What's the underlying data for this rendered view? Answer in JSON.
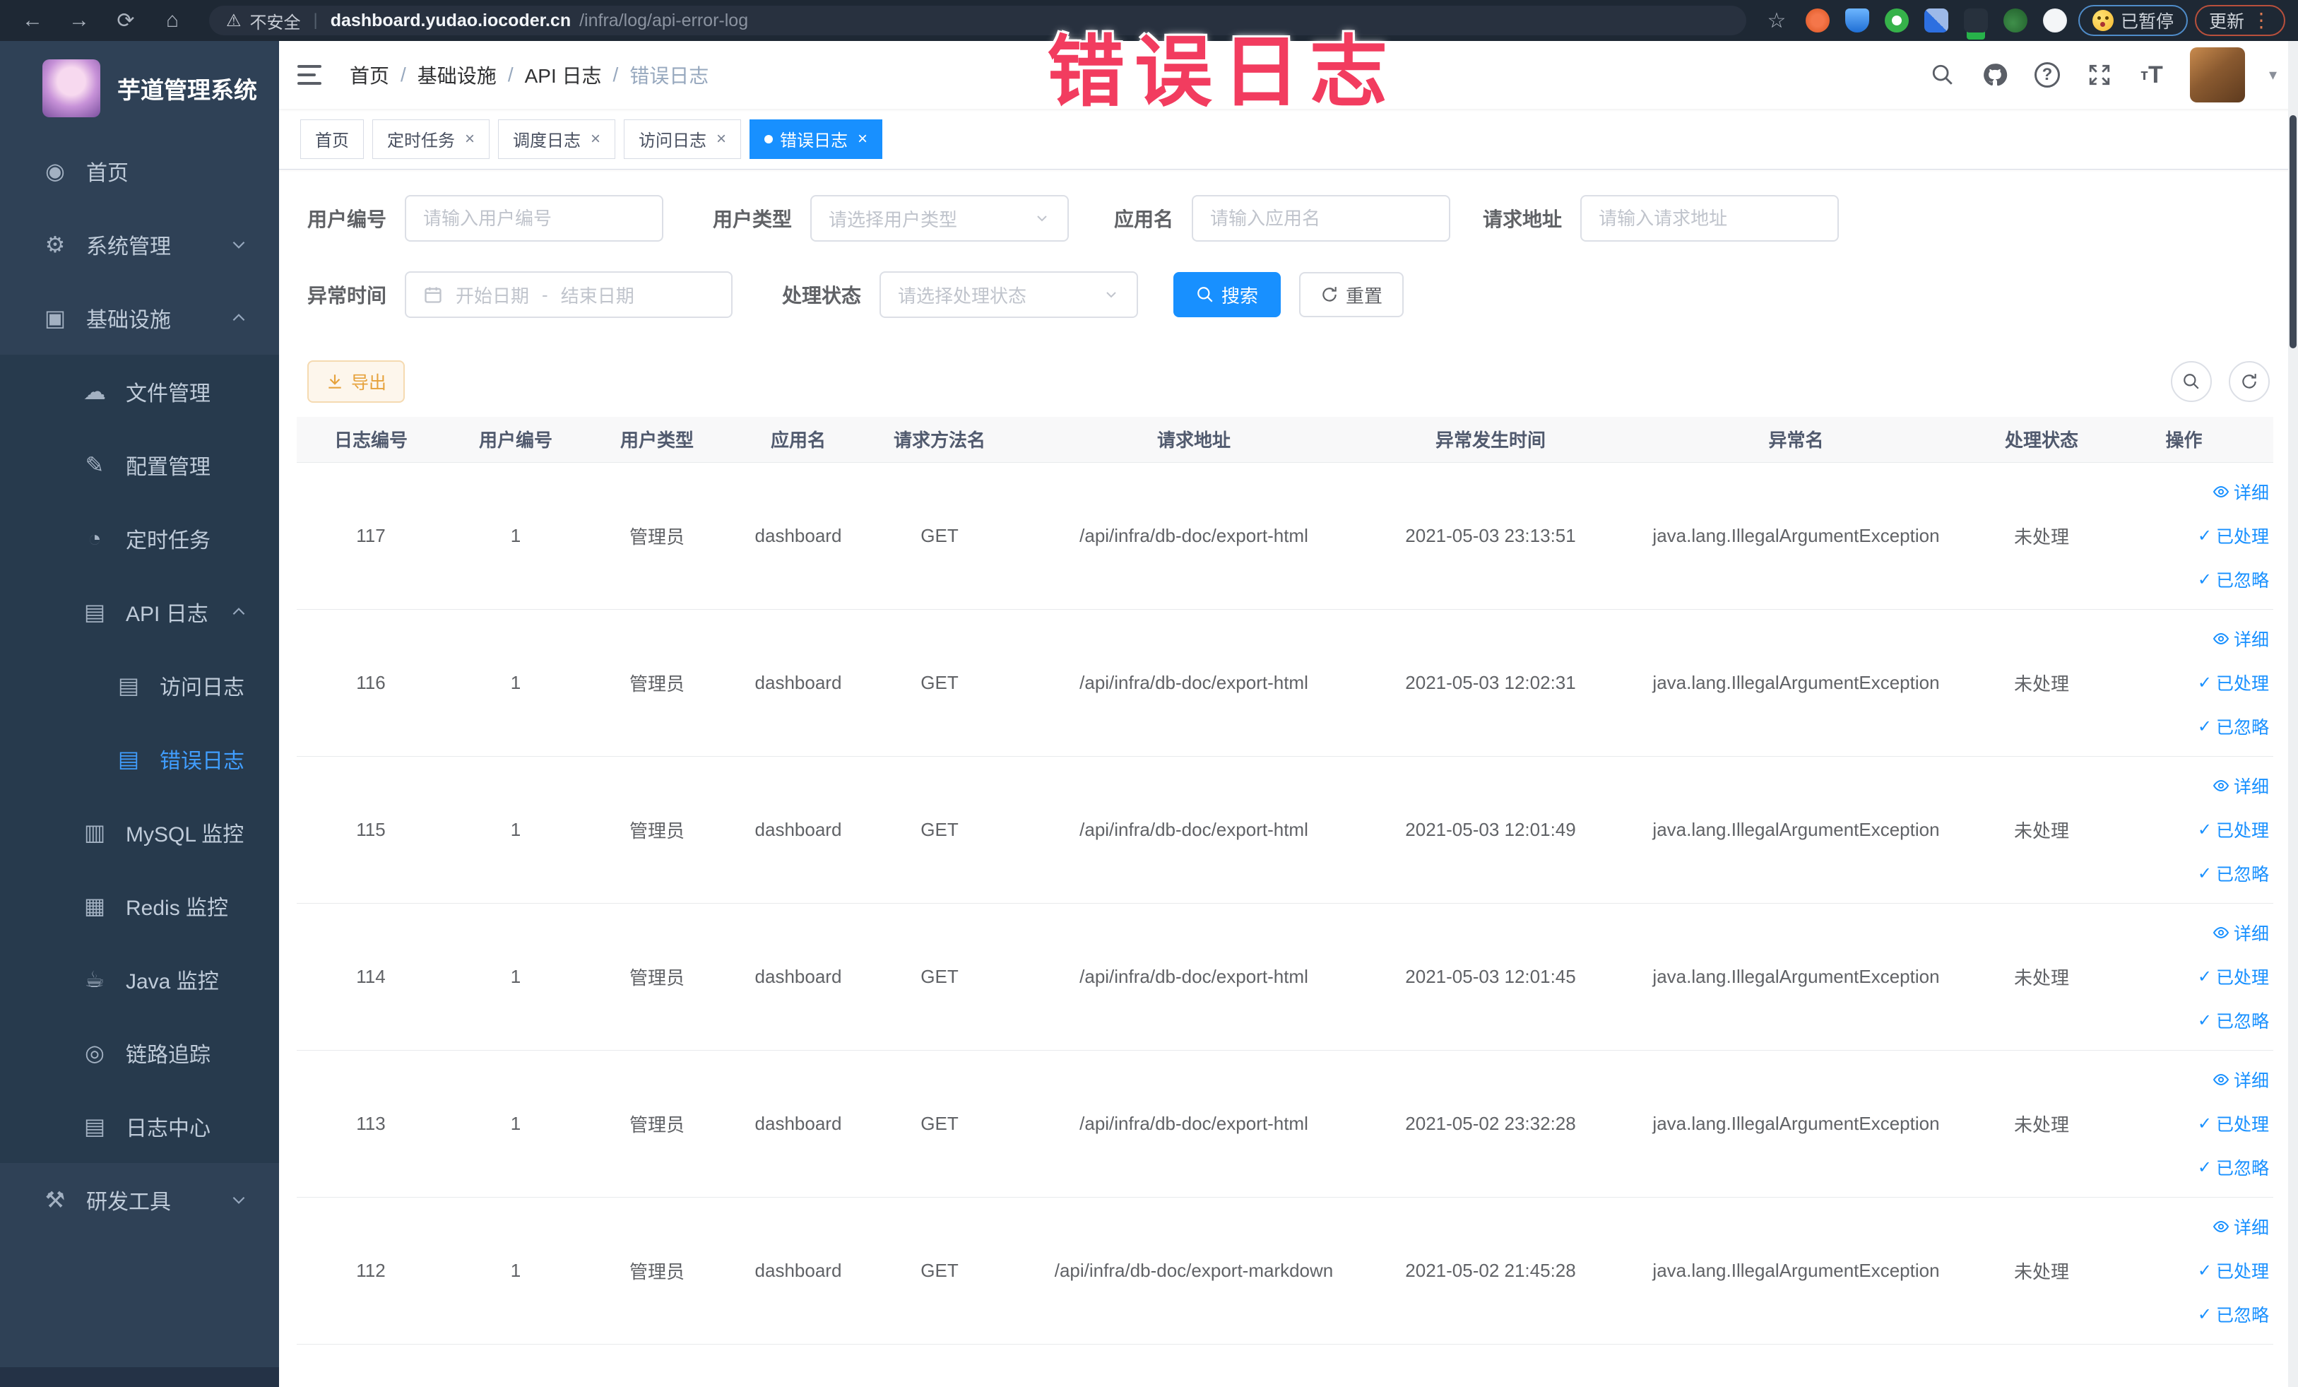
{
  "browser": {
    "security_warning": "不安全",
    "url_host": "dashboard.yudao.iocoder.cn",
    "url_path": "/infra/log/api-error-log",
    "url_separator": "|",
    "paused_badge": "已暂停",
    "update_button": "更新"
  },
  "overlay": {
    "title": "错误日志"
  },
  "colors": {
    "accent": "#1890ff",
    "sidebar_bg": "#2f4156",
    "submenu_bg": "#273a4d",
    "active_menu_text": "#409eff",
    "warning": "#e6a23c",
    "overlay_pink": "#f23c5f",
    "browser_bar": "#1e2834"
  },
  "icons": {
    "close": "×",
    "check": "✓",
    "caret_down": "▾",
    "warning_triangle": "⚠",
    "star": "☆",
    "back": "←",
    "forward": "→",
    "reload": "⟳",
    "home": "⌂",
    "dashboard": "◉",
    "gear": "⚙",
    "monitor": "▣",
    "cloud": "☁",
    "pencil": "✎",
    "timer": "◔",
    "doc": "▤",
    "chart": "▥",
    "db": "▦",
    "coffee": "☕",
    "eye": "◎",
    "tools": "⚒"
  },
  "sidebar": {
    "logo_title": "芋道管理系统",
    "items": [
      {
        "label": "首页"
      },
      {
        "label": "系统管理"
      },
      {
        "label": "基础设施"
      },
      {
        "label": "文件管理"
      },
      {
        "label": "配置管理"
      },
      {
        "label": "定时任务"
      },
      {
        "label": "API 日志"
      },
      {
        "label": "访问日志"
      },
      {
        "label": "错误日志"
      },
      {
        "label": "MySQL 监控"
      },
      {
        "label": "Redis 监控"
      },
      {
        "label": "Java 监控"
      },
      {
        "label": "链路追踪"
      },
      {
        "label": "日志中心"
      },
      {
        "label": "研发工具"
      }
    ]
  },
  "header": {
    "breadcrumb": [
      "首页",
      "基础设施",
      "API 日志",
      "错误日志"
    ],
    "breadcrumb_separator": "/"
  },
  "tabs": [
    {
      "label": "首页",
      "closable": false,
      "active": false
    },
    {
      "label": "定时任务",
      "closable": true,
      "active": false
    },
    {
      "label": "调度日志",
      "closable": true,
      "active": false
    },
    {
      "label": "访问日志",
      "closable": true,
      "active": false
    },
    {
      "label": "错误日志",
      "closable": true,
      "active": true
    }
  ],
  "filters": {
    "user_id": {
      "label": "用户编号",
      "placeholder": "请输入用户编号",
      "value": ""
    },
    "user_type": {
      "label": "用户类型",
      "placeholder": "请选择用户类型"
    },
    "app_name": {
      "label": "应用名",
      "placeholder": "请输入应用名",
      "value": ""
    },
    "request_url": {
      "label": "请求地址",
      "placeholder": "请输入请求地址",
      "value": ""
    },
    "exception_time": {
      "label": "异常时间",
      "start_placeholder": "开始日期",
      "separator": "-",
      "end_placeholder": "结束日期"
    },
    "process_status": {
      "label": "处理状态",
      "placeholder": "请选择处理状态"
    },
    "search_button": "搜索",
    "reset_button": "重置"
  },
  "toolbar": {
    "export_button": "导出"
  },
  "table": {
    "columns": [
      "日志编号",
      "用户编号",
      "用户类型",
      "应用名",
      "请求方法名",
      "请求地址",
      "异常发生时间",
      "异常名",
      "处理状态",
      "操作"
    ],
    "actions": [
      "详细",
      "已处理",
      "已忽略"
    ],
    "rows": [
      {
        "id": "117",
        "user_id": "1",
        "user_type": "管理员",
        "app": "dashboard",
        "method": "GET",
        "url": "/api/infra/db-doc/export-html",
        "time": "2021-05-03 23:13:51",
        "exception": "java.lang.IllegalArgumentException",
        "status": "未处理"
      },
      {
        "id": "116",
        "user_id": "1",
        "user_type": "管理员",
        "app": "dashboard",
        "method": "GET",
        "url": "/api/infra/db-doc/export-html",
        "time": "2021-05-03 12:02:31",
        "exception": "java.lang.IllegalArgumentException",
        "status": "未处理"
      },
      {
        "id": "115",
        "user_id": "1",
        "user_type": "管理员",
        "app": "dashboard",
        "method": "GET",
        "url": "/api/infra/db-doc/export-html",
        "time": "2021-05-03 12:01:49",
        "exception": "java.lang.IllegalArgumentException",
        "status": "未处理"
      },
      {
        "id": "114",
        "user_id": "1",
        "user_type": "管理员",
        "app": "dashboard",
        "method": "GET",
        "url": "/api/infra/db-doc/export-html",
        "time": "2021-05-03 12:01:45",
        "exception": "java.lang.IllegalArgumentException",
        "status": "未处理"
      },
      {
        "id": "113",
        "user_id": "1",
        "user_type": "管理员",
        "app": "dashboard",
        "method": "GET",
        "url": "/api/infra/db-doc/export-html",
        "time": "2021-05-02 23:32:28",
        "exception": "java.lang.IllegalArgumentException",
        "status": "未处理"
      },
      {
        "id": "112",
        "user_id": "1",
        "user_type": "管理员",
        "app": "dashboard",
        "method": "GET",
        "url": "/api/infra/db-doc/export-markdown",
        "time": "2021-05-02 21:45:28",
        "exception": "java.lang.IllegalArgumentException",
        "status": "未处理"
      }
    ]
  }
}
